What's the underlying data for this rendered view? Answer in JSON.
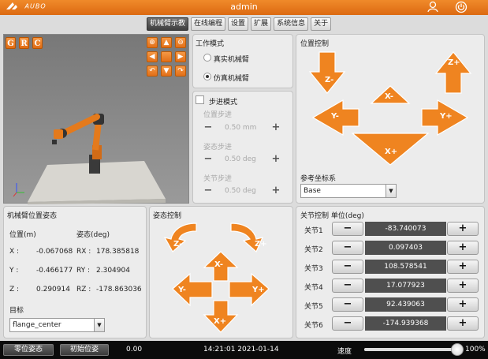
{
  "app": {
    "title": "admin",
    "logo": "AUBO"
  },
  "tabs": [
    {
      "label": "机械臂示教",
      "active": true
    },
    {
      "label": "在线编程"
    },
    {
      "label": "设置"
    },
    {
      "label": "扩展"
    },
    {
      "label": "系统信息"
    },
    {
      "label": "关于"
    }
  ],
  "viewer": {
    "view_buttons": [
      "G",
      "R",
      "C"
    ]
  },
  "work_mode": {
    "title": "工作模式",
    "options": [
      {
        "label": "真实机械臂",
        "selected": false
      },
      {
        "label": "仿真机械臂",
        "selected": true
      }
    ]
  },
  "step_mode": {
    "title": "步进模式",
    "checked": false,
    "position_label": "位置步进",
    "position_value": "0.50 mm",
    "attitude_label": "姿态步进",
    "attitude_value": "0.50 deg",
    "joint_label": "关节步进",
    "joint_value": "0.50 deg",
    "minus": "−",
    "plus": "+"
  },
  "position_control": {
    "title": "位置控制",
    "z_minus": "Z-",
    "z_plus": "Z+",
    "x_minus": "X-",
    "y_minus": "Y-",
    "y_plus": "Y+",
    "x_plus": "X+",
    "ref_label": "参考坐标系",
    "ref_value": "Base"
  },
  "pose": {
    "title": "机械臂位置姿态",
    "pos_header": "位置(m)",
    "att_header": "姿态(deg)",
    "x_label": "X :",
    "x_value": "-0.067068",
    "rx_label": "RX :",
    "rx_value": "178.385818",
    "y_label": "Y :",
    "y_value": "-0.466177",
    "ry_label": "RY :",
    "ry_value": "2.304904",
    "z_label": "Z :",
    "z_value": "0.290914",
    "rz_label": "RZ :",
    "rz_value": "-178.863036",
    "target_label": "目标",
    "target_value": "flange_center"
  },
  "attitude_control": {
    "title": "姿态控制",
    "z_minus": "Z-",
    "z_plus": "Z+",
    "x_minus": "X-",
    "y_minus": "Y-",
    "y_plus": "Y+",
    "x_plus": "X+"
  },
  "joint_control": {
    "title": "关节控制 单位(deg)",
    "minus": "−",
    "plus": "+",
    "joints": [
      {
        "label": "关节1",
        "value": "-83.740073"
      },
      {
        "label": "关节2",
        "value": "0.097403"
      },
      {
        "label": "关节3",
        "value": "108.578541"
      },
      {
        "label": "关节4",
        "value": "17.077923"
      },
      {
        "label": "关节5",
        "value": "92.439063"
      },
      {
        "label": "关节6",
        "value": "-174.939368"
      }
    ]
  },
  "status": {
    "zero_pose": "零位姿态",
    "init_pose": "初始位姿",
    "value": "0.00",
    "datetime": "2021-01-14 14:21:01",
    "speed_label": "速度",
    "speed_value": "100%",
    "speed_fraction": 1.0
  },
  "colors": {
    "accent": "#ef8420",
    "title_bar": "#e8781c"
  }
}
